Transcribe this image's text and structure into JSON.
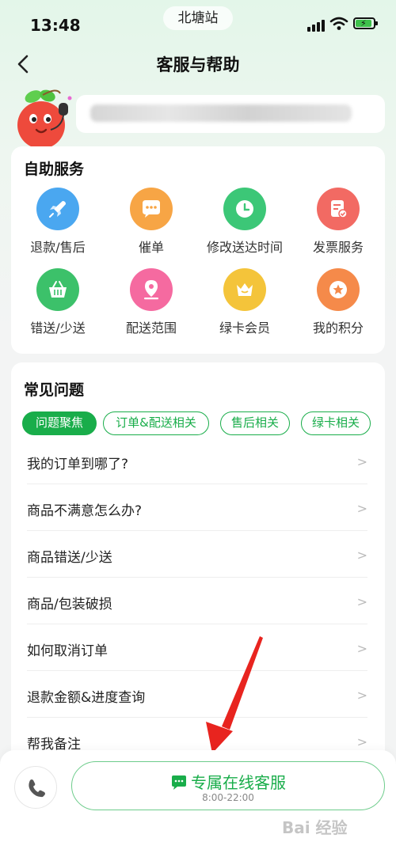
{
  "status_bar": {
    "time": "13:48",
    "location": "北塘站"
  },
  "nav": {
    "title": "客服与帮助"
  },
  "self_service": {
    "title": "自助服务",
    "items": [
      {
        "label": "退款/售后",
        "icon": "rocket-icon",
        "color": "#4aa7f0"
      },
      {
        "label": "催单",
        "icon": "chat-bubble-icon",
        "color": "#f7a545"
      },
      {
        "label": "修改送达时间",
        "icon": "clock-icon",
        "color": "#3cc777"
      },
      {
        "label": "发票服务",
        "icon": "invoice-icon",
        "color": "#f26a63"
      },
      {
        "label": "错送/少送",
        "icon": "basket-icon",
        "color": "#3cc16a"
      },
      {
        "label": "配送范围",
        "icon": "location-pin-icon",
        "color": "#f56aa0"
      },
      {
        "label": "绿卡会员",
        "icon": "crown-icon",
        "color": "#f4c43a"
      },
      {
        "label": "我的积分",
        "icon": "star-icon",
        "color": "#f58a4a"
      }
    ]
  },
  "faq": {
    "title": "常见问题",
    "tags": [
      "问题聚焦",
      "订单&配送相关",
      "售后相关",
      "绿卡相关"
    ],
    "active_tag": "问题聚焦",
    "questions": [
      "我的订单到哪了?",
      "商品不满意怎么办?",
      "商品错送/少送",
      "商品/包装破损",
      "如何取消订单",
      "退款金额&进度查询",
      "帮我备注"
    ]
  },
  "bottom": {
    "online_service_label": "专属在线客服",
    "online_service_hours": "8:00-22:00"
  },
  "watermark": "Bai 经验",
  "colors": {
    "accent": "#19ad4a",
    "annotation_arrow": "#e8241f"
  }
}
